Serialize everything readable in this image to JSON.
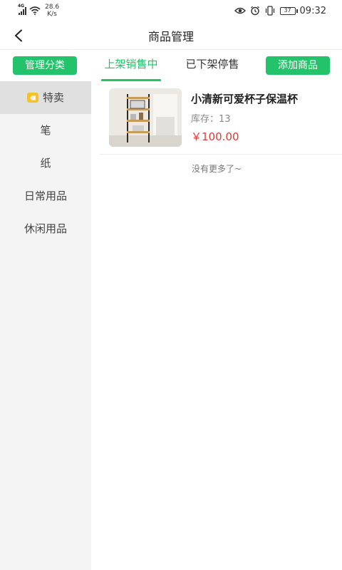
{
  "status_bar": {
    "network": "4G",
    "speed_value": "28.6",
    "speed_unit": "K/s",
    "battery": "37",
    "time": "09:32"
  },
  "navbar": {
    "title": "商品管理"
  },
  "toolbar": {
    "manage_label": "管理分类",
    "add_label": "添加商品",
    "tabs": [
      {
        "label": "上架销售中",
        "active": true
      },
      {
        "label": "已下架停售",
        "active": false
      }
    ]
  },
  "sidebar": {
    "items": [
      {
        "label": "特卖",
        "active": true,
        "icon": "hot-tag-icon"
      },
      {
        "label": "笔"
      },
      {
        "label": "纸"
      },
      {
        "label": "日常用品"
      },
      {
        "label": "休闲用品"
      }
    ]
  },
  "products": [
    {
      "name": "小清新可爱杯子保温杯",
      "stock": "库存：13",
      "price": "￥100.00"
    }
  ],
  "list_footer": "没有更多了~",
  "colors": {
    "accent": "#23c36b",
    "price": "#e23a3a",
    "sidebar_bg": "#f4f4f4",
    "sidebar_active_bg": "#e0e0e0"
  }
}
